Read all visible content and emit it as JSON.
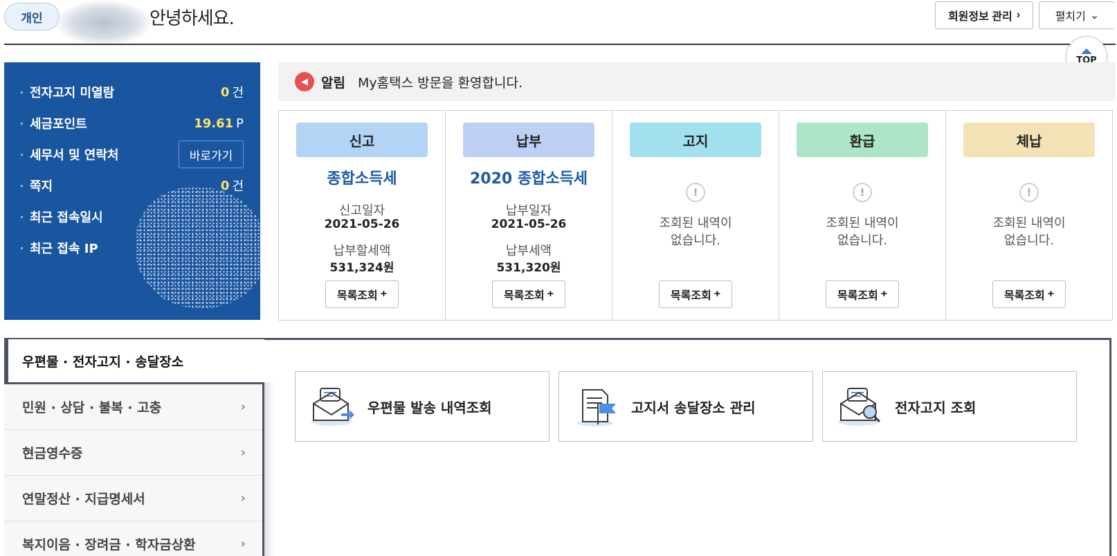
{
  "header": {
    "badge": "개인",
    "greeting": "안녕하세요.",
    "manage_btn": "회원정보 관리",
    "expand_btn": "펼치기",
    "top_label": "TOP"
  },
  "info_panel": {
    "rows": [
      {
        "label": "전자고지 미열람",
        "value": "0",
        "unit": "건"
      },
      {
        "label": "세금포인트",
        "value": "19.61",
        "unit": "P"
      },
      {
        "label": "세무서 및 연락처",
        "button": "바로가기"
      },
      {
        "label": "쪽지",
        "value": "0",
        "unit": "건"
      },
      {
        "label": "최근 접속일시"
      },
      {
        "label": "최근 접속 IP"
      }
    ]
  },
  "notice": {
    "title": "알림",
    "text": "My홈택스 방문을 환영합니다."
  },
  "cards": [
    {
      "head": "신고",
      "color": "#b3d4f5",
      "sub": "종합소득세",
      "k1": "신고일자",
      "v1": "2021-05-26",
      "k2": "납부할세액",
      "v2": "531,324원",
      "btn": "목록조회"
    },
    {
      "head": "납부",
      "color": "#bdd0f4",
      "sub": "2020 종합소득세",
      "k1": "납부일자",
      "v1": "2021-05-26",
      "k2": "납부세액",
      "v2": "531,320원",
      "btn": "목록조회"
    },
    {
      "head": "고지",
      "color": "#a3e0ee",
      "empty": "조회된 내역이\n없습니다.",
      "btn": "목록조회"
    },
    {
      "head": "환급",
      "color": "#aee5c8",
      "empty": "조회된 내역이\n없습니다.",
      "btn": "목록조회"
    },
    {
      "head": "체납",
      "color": "#f2e2b5",
      "empty": "조회된 내역이\n없습니다.",
      "btn": "목록조회"
    }
  ],
  "menu": {
    "active": "우편물 · 전자고지 · 송달장소",
    "items": [
      "민원 · 상담 · 불복 · 고충",
      "현금영수증",
      "연말정산 · 지급명세서",
      "복지이음 · 장려금 · 학자금상환"
    ]
  },
  "tiles": [
    {
      "label": "우편물 발송 내역조회",
      "icon": "mail-send-icon"
    },
    {
      "label": "고지서 송달장소 관리",
      "icon": "document-flag-icon"
    },
    {
      "label": "전자고지 조회",
      "icon": "mail-search-icon"
    }
  ],
  "colors": {
    "panel_blue": "#1a55a0",
    "point_yellow": "#ffe36a",
    "accent_blue": "#1e5aa5",
    "notice_red": "#e6504e"
  }
}
